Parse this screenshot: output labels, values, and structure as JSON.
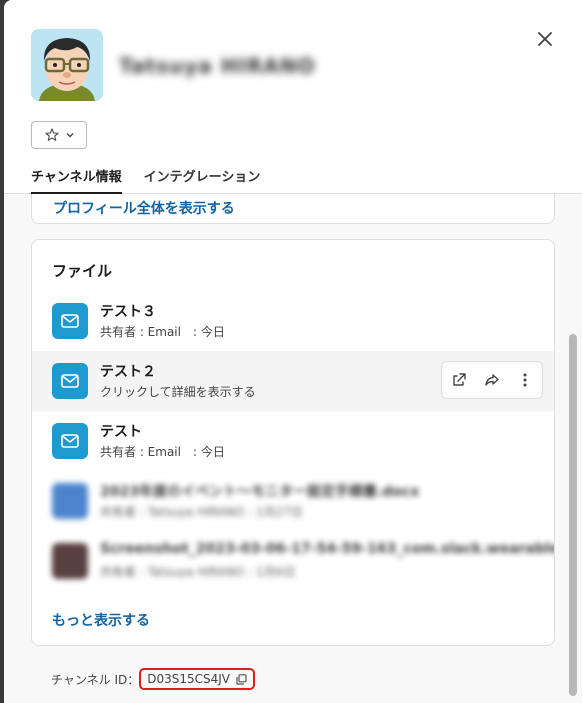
{
  "profile": {
    "name": "Tatsuya HIRANO"
  },
  "tabs": [
    {
      "label": "チャンネル情報"
    },
    {
      "label": "インテグレーション"
    }
  ],
  "profile_card": {
    "link": "プロフィール全体を表示する"
  },
  "files": {
    "title": "ファイル",
    "items": [
      {
        "name": "テスト３",
        "meta": "共有者 : Email　: 今日"
      },
      {
        "name": "テスト２",
        "meta": "クリックして詳細を表示する"
      },
      {
        "name": "テスト",
        "meta": "共有者 : Email　: 今日"
      },
      {
        "name": "2023年度のイベント～モニター設定手順書.docx",
        "meta": "共有者 : Tatsuya HIRANO : 1月27日"
      },
      {
        "name": "Screenshot_2023-03-06-17-54-59-163_com.slack.wearable...",
        "meta": "共有者 : Tatsuya HIRANO : 1月6日"
      }
    ],
    "more_link": "もっと表示する"
  },
  "channel_id": {
    "label": "チャンネル ID：",
    "value": "D03S15CS4JV"
  },
  "colors": {
    "link": "#1264a3",
    "file_icon": "#1d9bd1",
    "highlight_box": "#e01e1e"
  },
  "icons": {
    "close": "close-icon",
    "star": "star-icon",
    "chevron": "chevron-down-icon",
    "email_file": "email-icon",
    "open_external": "external-link-icon",
    "share": "share-icon",
    "more": "more-vertical-icon",
    "copy": "copy-icon"
  }
}
